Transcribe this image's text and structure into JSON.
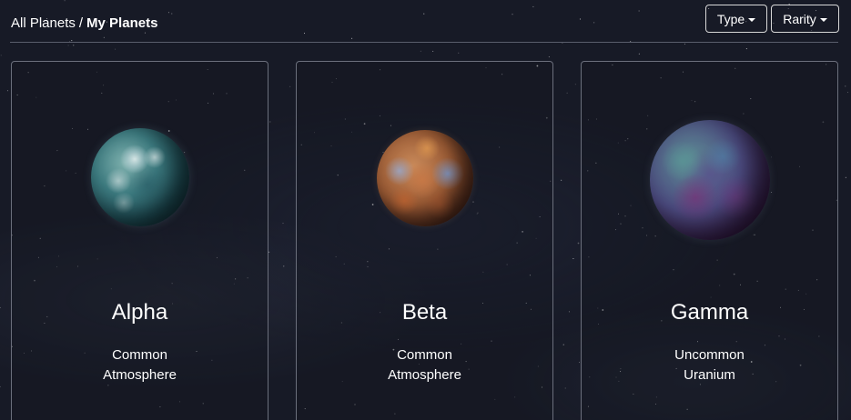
{
  "breadcrumb": {
    "parent": "All Planets",
    "separator": "/",
    "current": "My Planets"
  },
  "filters": {
    "type_label": "Type",
    "rarity_label": "Rarity"
  },
  "planets": [
    {
      "name": "Alpha",
      "rarity": "Common",
      "type": "Atmosphere"
    },
    {
      "name": "Beta",
      "rarity": "Common",
      "type": "Atmosphere"
    },
    {
      "name": "Gamma",
      "rarity": "Uncommon",
      "type": "Uranium"
    }
  ]
}
